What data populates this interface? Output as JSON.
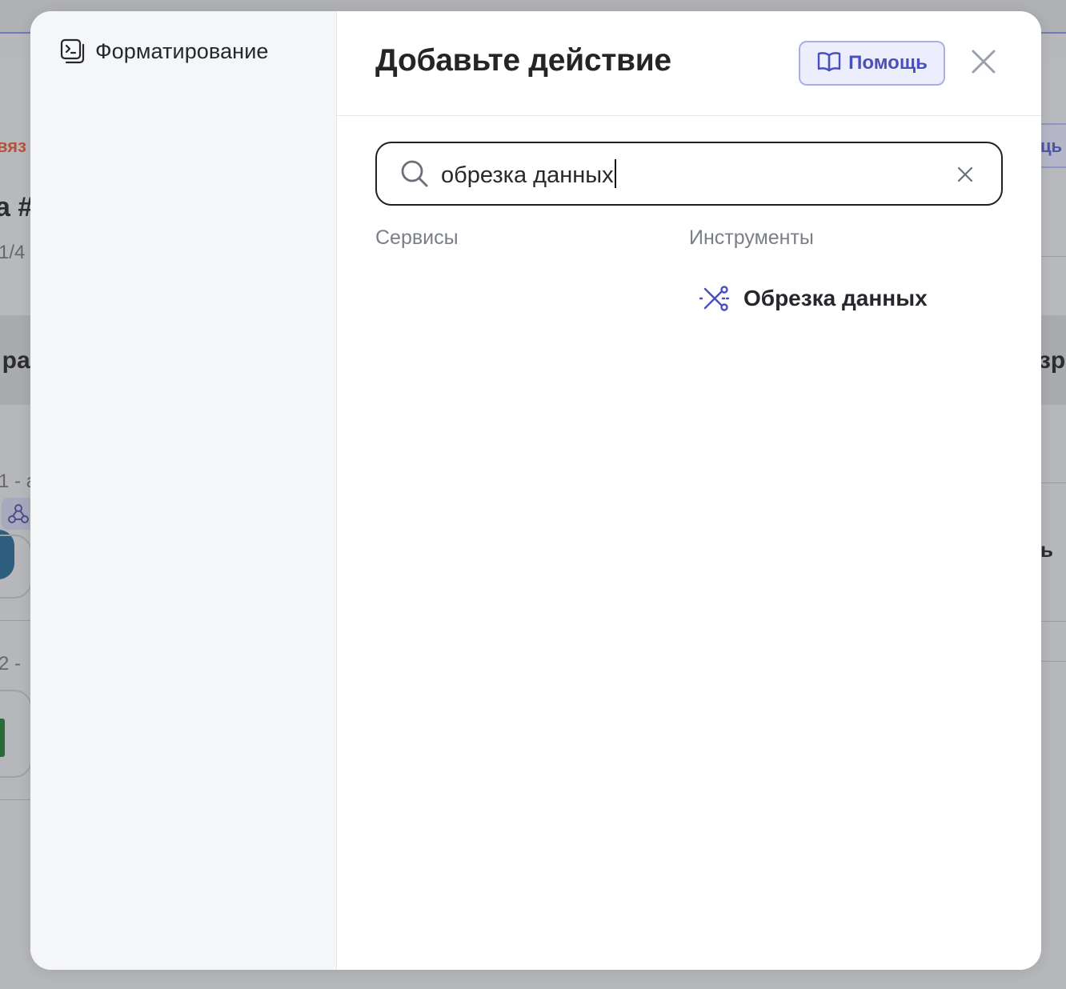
{
  "background": {
    "fragments": {
      "link_red": "вяз",
      "heading": "а #",
      "counter": "1/4",
      "section": "і ра",
      "section_right": "зре",
      "row1": "1 - а",
      "row2": "2 -",
      "button_right": "ць",
      "right_glyph": "ь"
    }
  },
  "modal": {
    "sidebar": {
      "items": [
        {
          "label": "Форматирование",
          "icon": "terminal-window-icon"
        }
      ]
    },
    "header": {
      "title": "Добавьте действие",
      "help_label": "Помощь",
      "help_icon": "book-open-icon",
      "close_icon": "close-icon"
    },
    "search": {
      "value": "обрезка данных",
      "icon": "search-icon",
      "clear_icon": "clear-icon"
    },
    "columns": {
      "services_title": "Сервисы",
      "tools_title": "Инструменты"
    },
    "tools": [
      {
        "label": "Обрезка данных",
        "icon": "scissors-cut-data-icon"
      }
    ]
  },
  "colors": {
    "accent": "#4a4fbf",
    "help_bg": "#eceefd",
    "help_border": "#a9aee6",
    "sidebar_bg": "#f5f6f8",
    "overlay": "#b7b8bb"
  }
}
